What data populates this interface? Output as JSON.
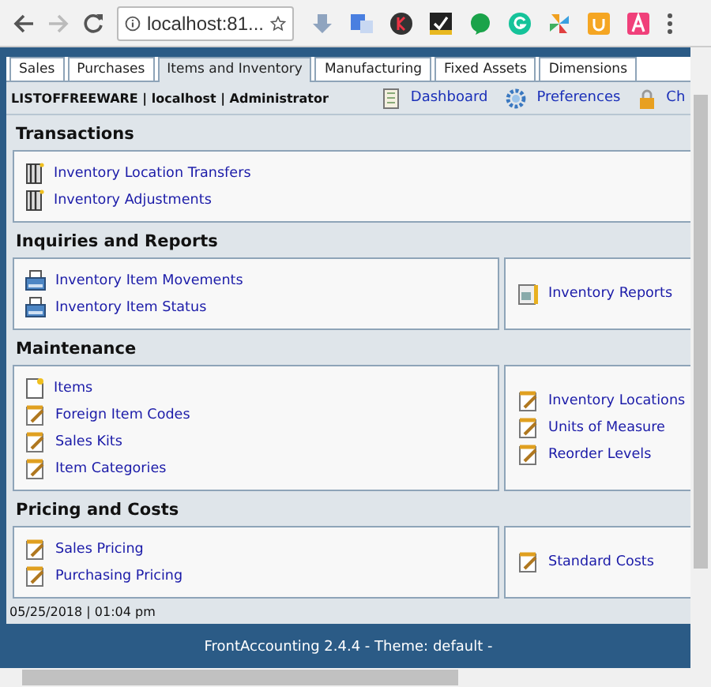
{
  "browser": {
    "address": "localhost:81..."
  },
  "tabs": [
    {
      "label": "Sales",
      "selected": false
    },
    {
      "label": "Purchases",
      "selected": false
    },
    {
      "label": "Items and Inventory",
      "selected": true
    },
    {
      "label": "Manufacturing",
      "selected": false
    },
    {
      "label": "Fixed Assets",
      "selected": false
    },
    {
      "label": "Dimensions",
      "selected": false
    }
  ],
  "user_bar": {
    "info": "LISTOFFREEWARE | localhost | Administrator",
    "links": [
      {
        "label": "Dashboard",
        "kind": "book"
      },
      {
        "label": "Preferences",
        "kind": "gear"
      },
      {
        "label": "Ch",
        "kind": "lock"
      }
    ]
  },
  "sections": [
    {
      "title": "Transactions",
      "left": [
        {
          "label": "Inventory Location Transfers",
          "kind": "binder"
        },
        {
          "label": "Inventory Adjustments",
          "kind": "binder"
        }
      ]
    },
    {
      "title": "Inquiries and Reports",
      "left": [
        {
          "label": "Inventory Item Movements",
          "kind": "printer"
        },
        {
          "label": "Inventory Item Status",
          "kind": "printer"
        }
      ],
      "right": [
        {
          "label": "Inventory Reports",
          "kind": "report"
        }
      ]
    },
    {
      "title": "Maintenance",
      "left": [
        {
          "label": "Items",
          "kind": "page"
        },
        {
          "label": "Foreign Item Codes",
          "kind": "notepad"
        },
        {
          "label": "Sales Kits",
          "kind": "notepad"
        },
        {
          "label": "Item Categories",
          "kind": "notepad"
        }
      ],
      "right": [
        {
          "label": "Inventory Locations",
          "kind": "notepad"
        },
        {
          "label": "Units of Measure",
          "kind": "notepad"
        },
        {
          "label": "Reorder Levels",
          "kind": "notepad"
        }
      ]
    },
    {
      "title": "Pricing and Costs",
      "left": [
        {
          "label": "Sales Pricing",
          "kind": "notepad"
        },
        {
          "label": "Purchasing Pricing",
          "kind": "notepad"
        }
      ],
      "right": [
        {
          "label": "Standard Costs",
          "kind": "notepad"
        }
      ]
    }
  ],
  "date_line": "05/25/2018 | 01:04 pm",
  "footer": "FrontAccounting 2.4.4 - Theme: default -"
}
